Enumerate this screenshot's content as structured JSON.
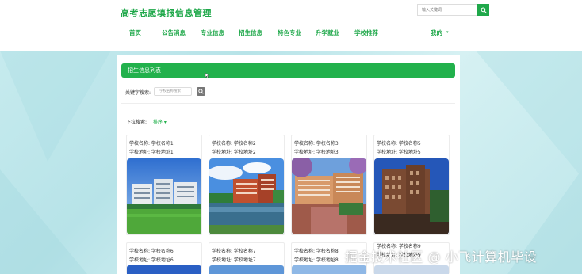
{
  "site": {
    "title": "高考志愿填报信息管理"
  },
  "search": {
    "placeholder": "输入关键词"
  },
  "nav": {
    "items": [
      "首页",
      "公告消息",
      "专业信息",
      "招生信息",
      "特色专业",
      "升学就业",
      "学校推荐"
    ],
    "mine": "我的"
  },
  "panel": {
    "title": "招生信息列表",
    "keyword_label": "关键字搜索:",
    "keyword_placeholder": "学校名称搜索",
    "dropdown_label": "下拉搜索:",
    "sort_label": "排序"
  },
  "cards": [
    {
      "name": "学校名称: 学校名称1",
      "address": "学校地址: 学校地址1",
      "scene": "campus-buildings"
    },
    {
      "name": "学校名称: 学校名称2",
      "address": "学校地址: 学校地址2",
      "scene": "campus-lake"
    },
    {
      "name": "学校名称: 学校名称3",
      "address": "学校地址: 学校地址3",
      "scene": "campus-gate"
    },
    {
      "name": "学校名称: 学校名称5",
      "address": "学校地址: 学校地址5",
      "scene": "campus-brick"
    },
    {
      "name": "学校名称: 学校名称6",
      "address": "学校地址: 学校地址6",
      "scene": "campus-sky"
    },
    {
      "name": "学校名称: 学校名称7",
      "address": "学校地址: 学校地址7",
      "scene": "campus-sky"
    },
    {
      "name": "学校名称: 学校名称8",
      "address": "学校地址: 学校地址8",
      "scene": "campus-sky"
    },
    {
      "name": "学校名称: 学校名称9",
      "address": "学校地址: 学校地址9",
      "scene": "campus-sky"
    }
  ],
  "watermark": "掘金技术社区 @ 小飞计算机毕设",
  "colors": {
    "accent": "#22b14c",
    "title_green": "#1fa84a"
  }
}
